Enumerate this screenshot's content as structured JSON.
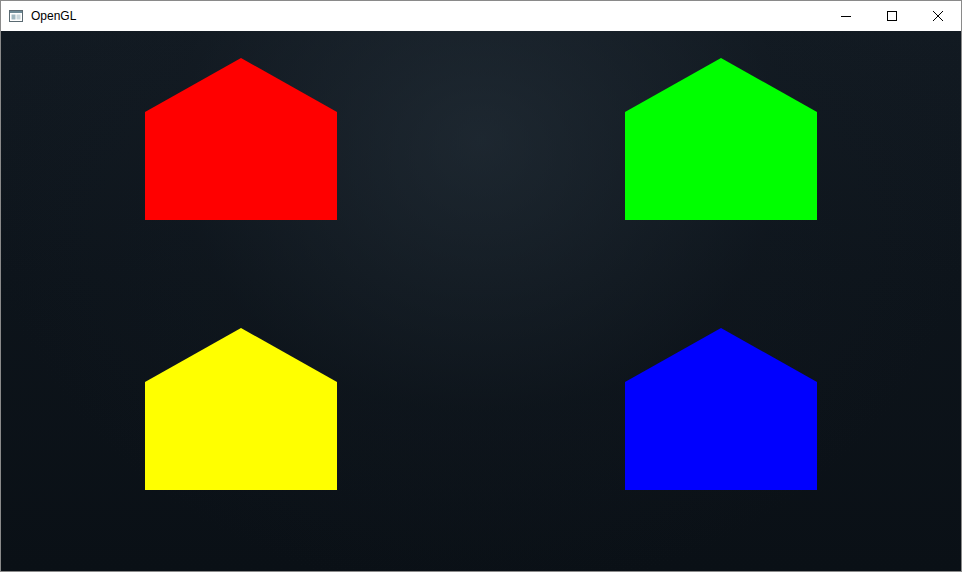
{
  "window": {
    "title": "OpenGL"
  },
  "houses": [
    {
      "color": "#ff0000"
    },
    {
      "color": "#00ff00"
    },
    {
      "color": "#ffff00"
    },
    {
      "color": "#0000ff"
    }
  ]
}
